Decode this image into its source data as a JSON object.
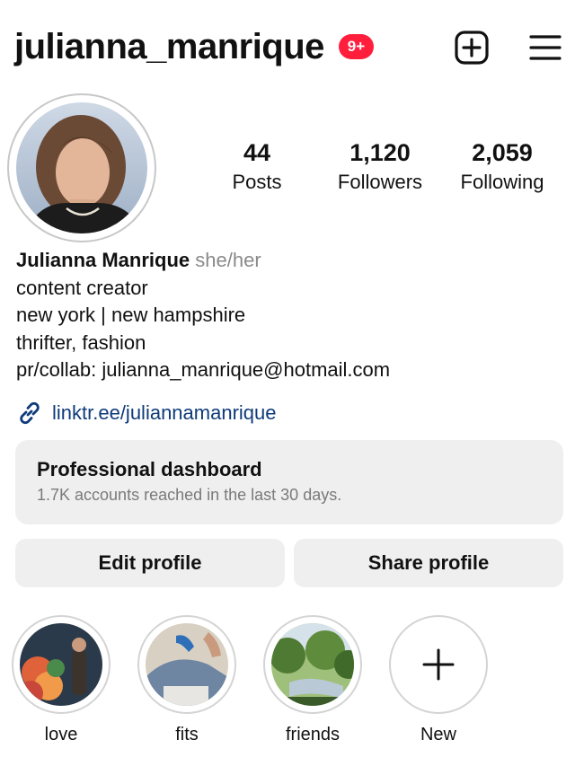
{
  "header": {
    "username": "julianna_manrique",
    "notification_badge": "9+",
    "icons": [
      "new-post-icon",
      "menu-icon"
    ]
  },
  "profile": {
    "stats": {
      "posts": {
        "value": "44",
        "label": "Posts"
      },
      "followers": {
        "value": "1,120",
        "label": "Followers"
      },
      "following": {
        "value": "2,059",
        "label": "Following"
      }
    },
    "display_name": "Julianna Manrique",
    "pronouns": "she/her",
    "bio_lines": [
      "content creator",
      "new york | new hampshire",
      "thrifter, fashion",
      "pr/collab: julianna_manrique@hotmail.com"
    ],
    "link": "linktr.ee/juliannamanrique"
  },
  "dashboard": {
    "title": "Professional dashboard",
    "subtitle": "1.7K accounts reached in the last 30 days."
  },
  "buttons": {
    "edit": "Edit profile",
    "share": "Share profile"
  },
  "highlights": [
    {
      "label": "love"
    },
    {
      "label": "fits"
    },
    {
      "label": "friends"
    },
    {
      "label": "New"
    }
  ],
  "colors": {
    "badge": "#ff1f3d",
    "link": "#0f3b7a",
    "button_bg": "#efefef",
    "muted_text": "#7a7a7a"
  }
}
